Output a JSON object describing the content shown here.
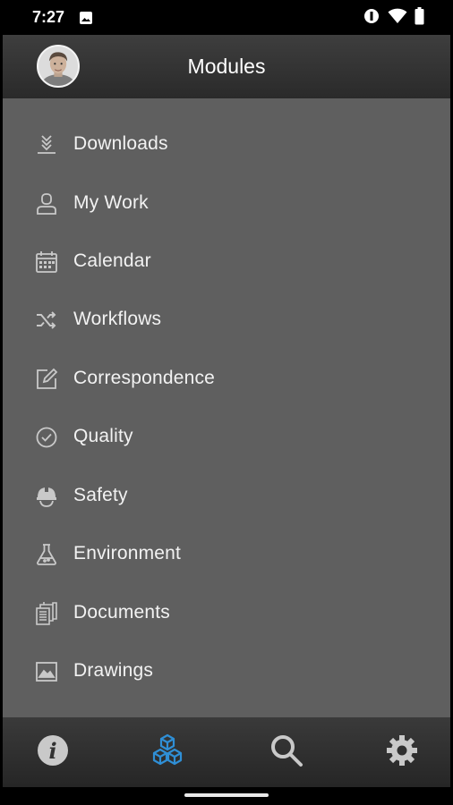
{
  "status_bar": {
    "time": "7:27"
  },
  "header": {
    "title": "Modules"
  },
  "menu": {
    "items": [
      {
        "label": "Downloads",
        "icon": "downloads-icon"
      },
      {
        "label": "My Work",
        "icon": "person-icon"
      },
      {
        "label": "Calendar",
        "icon": "calendar-icon"
      },
      {
        "label": "Workflows",
        "icon": "shuffle-icon"
      },
      {
        "label": "Correspondence",
        "icon": "edit-icon"
      },
      {
        "label": "Quality",
        "icon": "check-circle-icon"
      },
      {
        "label": "Safety",
        "icon": "hard-hat-icon"
      },
      {
        "label": "Environment",
        "icon": "flask-icon"
      },
      {
        "label": "Documents",
        "icon": "documents-icon"
      },
      {
        "label": "Drawings",
        "icon": "image-icon"
      }
    ]
  },
  "bottom_nav": {
    "active": "modules",
    "items": [
      "info-icon",
      "modules-cubes-icon",
      "search-icon",
      "settings-gear-icon"
    ]
  },
  "colors": {
    "accent": "#2f8fd6",
    "menu_bg": "#5f5f5f",
    "icon_gray": "#c9c9c9"
  }
}
